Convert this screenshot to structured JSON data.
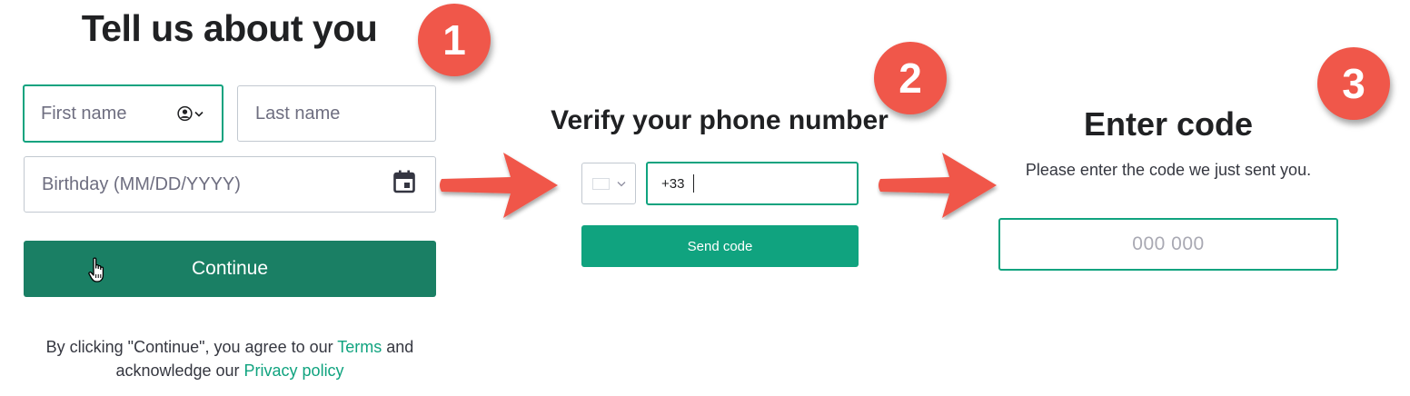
{
  "step1": {
    "title": "Tell us about you",
    "first_name_placeholder": "First name",
    "last_name_placeholder": "Last name",
    "birthday_placeholder": "Birthday (MM/DD/YYYY)",
    "continue_label": "Continue",
    "legal_prefix": "By clicking \"Continue\", you agree to our ",
    "terms_link": "Terms",
    "legal_middle": " and acknowledge our ",
    "privacy_link": "Privacy policy",
    "badge": "1"
  },
  "step2": {
    "title": "Verify your phone number",
    "phone_value": "+33",
    "send_label": "Send code",
    "badge": "2"
  },
  "step3": {
    "title": "Enter code",
    "subtitle": "Please enter the code we just sent you.",
    "code_placeholder": "000 000",
    "badge": "3"
  },
  "icons": {
    "person": "person-circle-icon",
    "chevron": "chevron-down-icon",
    "calendar": "calendar-icon",
    "cursor": "hand-pointer-icon",
    "arrow": "arrow-right-icon"
  },
  "colors": {
    "accent": "#10a37f",
    "button_dark": "#1a7f64",
    "badge": "#f0574a",
    "arrow": "#f0574a"
  }
}
